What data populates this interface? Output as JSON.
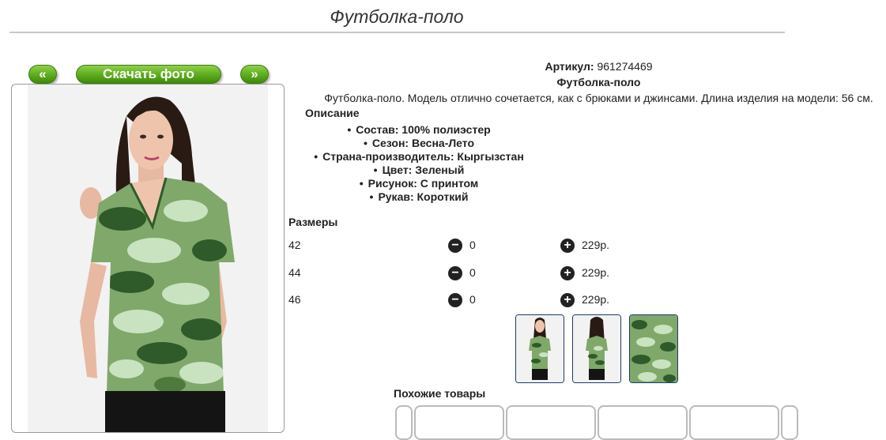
{
  "page": {
    "title": "Футболка-поло"
  },
  "photo_nav": {
    "prev": "«",
    "download": "Скачать фото",
    "next": "»"
  },
  "product": {
    "article_label": "Артикул:",
    "article_value": "961274469",
    "name": "Футболка-поло",
    "summary": "Футболка-поло. Модель отлично сочетается, как с брюками и джинсами. Длина изделия на модели: 56 см.",
    "description_heading": "Описание",
    "attributes": [
      "Состав: 100% полиэстер",
      "Сезон: Весна-Лето",
      "Страна-производитель: Кыргызстан",
      "Цвет: Зеленый",
      "Рисунок: С принтом",
      "Рукав: Короткий"
    ]
  },
  "sizes": {
    "heading": "Размеры",
    "rows": [
      {
        "size": "42",
        "qty": "0",
        "price": "229р."
      },
      {
        "size": "44",
        "qty": "0",
        "price": "229р."
      },
      {
        "size": "46",
        "qty": "0",
        "price": "229р."
      }
    ]
  },
  "similar": {
    "heading": "Похожие товары"
  },
  "colors": {
    "accent_green": "#5bab1c",
    "camo_dark": "#2f5a2a",
    "camo_mid": "#7fa86a",
    "camo_light": "#c9e3c0"
  }
}
